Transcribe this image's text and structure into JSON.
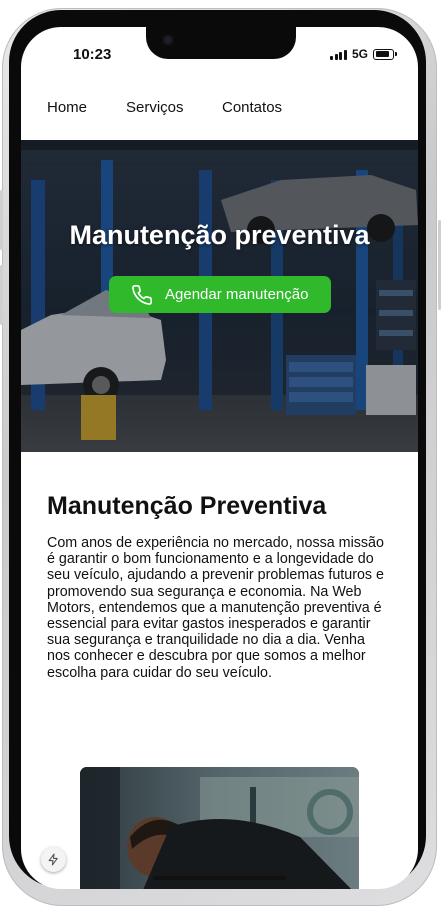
{
  "status_bar": {
    "time": "10:23",
    "network": "5G",
    "icons": [
      "signal-icon",
      "battery-icon"
    ]
  },
  "nav": {
    "items": [
      {
        "label": "Home"
      },
      {
        "label": "Serviços"
      },
      {
        "label": "Contatos"
      }
    ]
  },
  "hero": {
    "title": "Manutenção preventiva",
    "cta_label": "Agendar manutenção",
    "cta_icon": "phone-icon",
    "cta_color": "#2fb92b"
  },
  "content": {
    "heading": "Manutenção Preventiva",
    "paragraph": "Com anos de experiência no mercado, nossa missão é garantir o bom funcionamento e a longevidade do seu veículo, ajudando a prevenir problemas futuros e promovendo sua segurança e economia. Na Web Motors, entendemos que a manutenção preventiva é essencial para evitar gastos inesperados e garantir sua segurança e tranquilidade no dia a dia. Venha nos conhecer e descubra por que somos a melhor escolha para cuidar do seu veículo."
  },
  "floating_badge": {
    "icon": "bolt-icon"
  }
}
